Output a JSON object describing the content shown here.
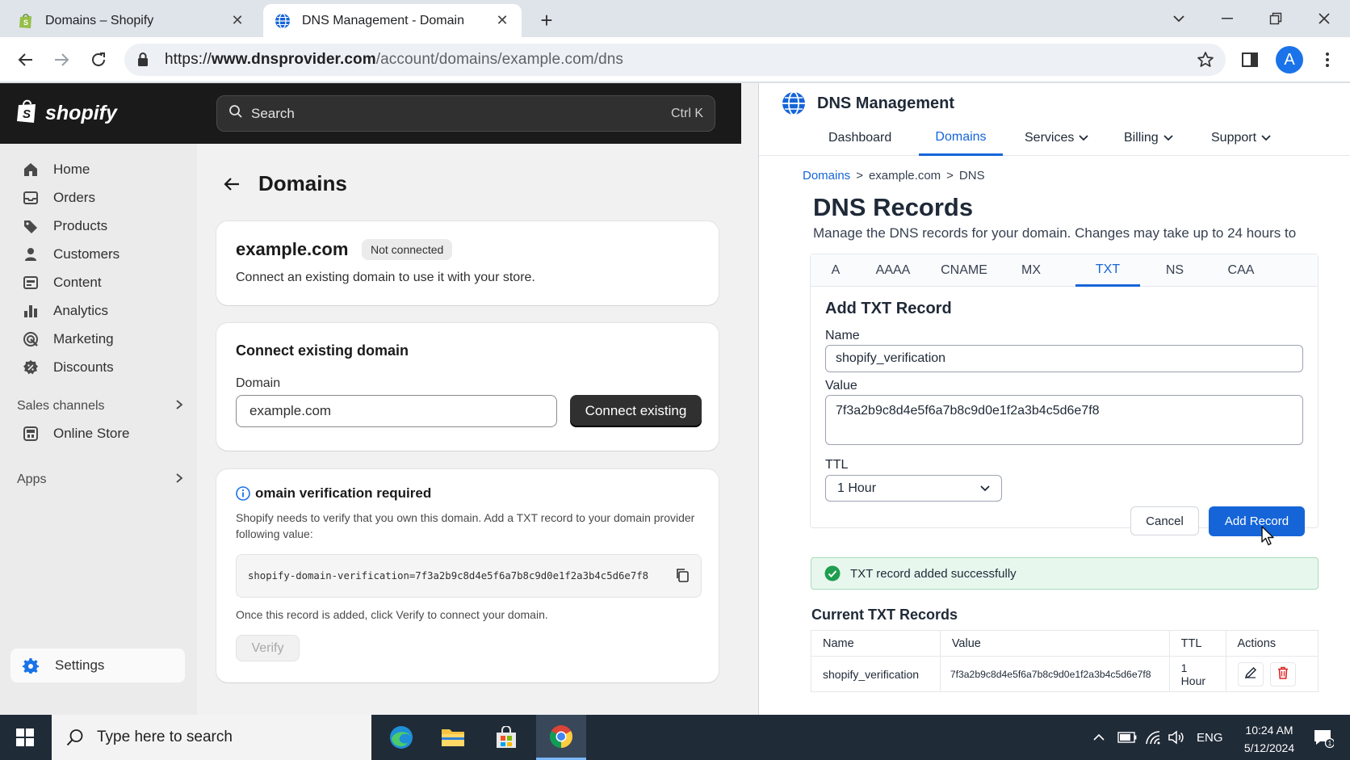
{
  "browser": {
    "tabs": [
      {
        "title": "Domains – Shopify",
        "active": false
      },
      {
        "title": "DNS Management - Domain",
        "active": true
      }
    ],
    "url": {
      "scheme": "https://",
      "host": "www.dnsprovider.com",
      "path": "/account/domains/example.com/dns"
    },
    "avatar_letter": "A"
  },
  "shopify": {
    "brand": "shopify",
    "search_placeholder": "Search",
    "search_shortcut": "Ctrl K",
    "nav": [
      {
        "label": "Home",
        "icon": "home-icon"
      },
      {
        "label": "Orders",
        "icon": "orders-icon"
      },
      {
        "label": "Products",
        "icon": "tag-icon"
      },
      {
        "label": "Customers",
        "icon": "person-icon"
      },
      {
        "label": "Content",
        "icon": "content-icon"
      },
      {
        "label": "Analytics",
        "icon": "bar-chart-icon"
      },
      {
        "label": "Marketing",
        "icon": "target-icon"
      },
      {
        "label": "Discounts",
        "icon": "discount-icon"
      }
    ],
    "sales_channels": "Sales channels",
    "online_store": "Online Store",
    "apps": "Apps",
    "settings": "Settings",
    "page_title": "Domains",
    "domain_card": {
      "domain": "example.com",
      "badge": "Not connected",
      "desc": "Connect an existing domain to use it with your store."
    },
    "connect_card": {
      "title": "Connect existing domain",
      "field_label": "Domain",
      "field_value": "example.com",
      "button": "Connect existing"
    },
    "verify_card": {
      "title": "omain verification required",
      "text": "Shopify needs to verify that you own this domain. Add a TXT record to your domain provider following value:",
      "code": "shopify-domain-verification=7f3a2b9c8d4e5f6a7b8c9d0e1f2a3b4c5d6e7f8",
      "after": "Once this record is added, click Verify to connect your domain.",
      "button": "Verify"
    }
  },
  "dns": {
    "brand": "DNS Management",
    "tabs": [
      {
        "label": "Dashboard"
      },
      {
        "label": "Domains"
      },
      {
        "label": "Services"
      },
      {
        "label": "Billing"
      },
      {
        "label": "Support"
      }
    ],
    "breadcrumb": [
      "Domains",
      "example.com",
      "DNS"
    ],
    "breadcrumb_sep": ">",
    "title": "DNS Records",
    "desc": "Manage the DNS records for your domain. Changes may take up to 24 hours to",
    "record_tabs": [
      "A",
      "AAAA",
      "CNAME",
      "MX",
      "TXT",
      "NS",
      "CAA"
    ],
    "form": {
      "title": "Add TXT Record",
      "name_label": "Name",
      "name_value": "shopify_verification",
      "value_label": "Value",
      "value_value": "7f3a2b9c8d4e5f6a7b8c9d0e1f2a3b4c5d6e7f8",
      "ttl_label": "TTL",
      "ttl_value": "1 Hour",
      "cancel": "Cancel",
      "add": "Add Record"
    },
    "success": "TXT record added successfully",
    "current_title": "Current TXT Records",
    "table": {
      "headers": [
        "Name",
        "Value",
        "TTL",
        "Actions"
      ],
      "rows": [
        {
          "name": "shopify_verification",
          "value": "7f3a2b9c8d4e5f6a7b8c9d0e1f2a3b4c5d6e7f8",
          "ttl": "1 Hour"
        }
      ]
    },
    "colors": {
      "accent": "#1565d8",
      "success": "#1e9e4f",
      "danger": "#dc2626"
    }
  },
  "taskbar": {
    "search_placeholder": "Type here to search",
    "lang": "ENG",
    "time": "10:24 AM",
    "date": "5/12/2024",
    "notif_count": "1"
  }
}
